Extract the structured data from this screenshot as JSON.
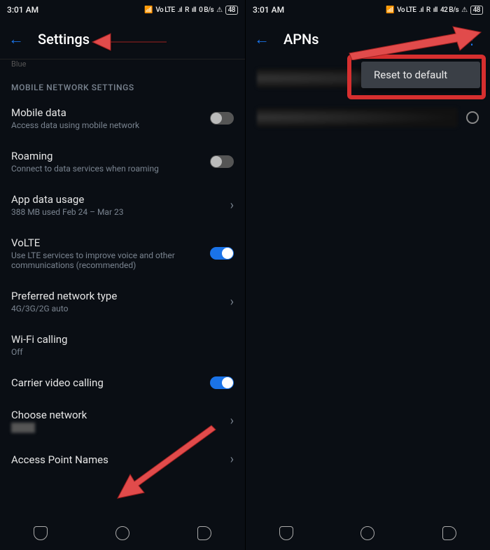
{
  "status": {
    "time": "3:01 AM",
    "volte": "Vo LTE",
    "sig": ".ıl",
    "roam": "R",
    "sig2": "ıll",
    "data": "0 B/s",
    "data2": "42 B/s",
    "warn": "⚠",
    "batt": "48"
  },
  "left": {
    "title": "Settings",
    "faded": "Blue",
    "section": "MOBILE NETWORK SETTINGS",
    "rows": {
      "mobile_data": {
        "t": "Mobile data",
        "s": "Access data using mobile network"
      },
      "roaming": {
        "t": "Roaming",
        "s": "Connect to data services when roaming"
      },
      "app_data": {
        "t": "App data usage",
        "s": "388 MB used Feb 24 – Mar 23"
      },
      "volte": {
        "t": "VoLTE",
        "s": "Use LTE services to improve voice and other communications (recommended)"
      },
      "pref_net": {
        "t": "Preferred network type",
        "s": "4G/3G/2G auto"
      },
      "wifi_call": {
        "t": "Wi-Fi calling",
        "s": "Off"
      },
      "cvc": {
        "t": "Carrier video calling"
      },
      "choose_net": {
        "t": "Choose network"
      },
      "apn": {
        "t": "Access Point Names"
      }
    }
  },
  "right": {
    "title": "APNs",
    "menu": {
      "reset": "Reset to default"
    }
  }
}
